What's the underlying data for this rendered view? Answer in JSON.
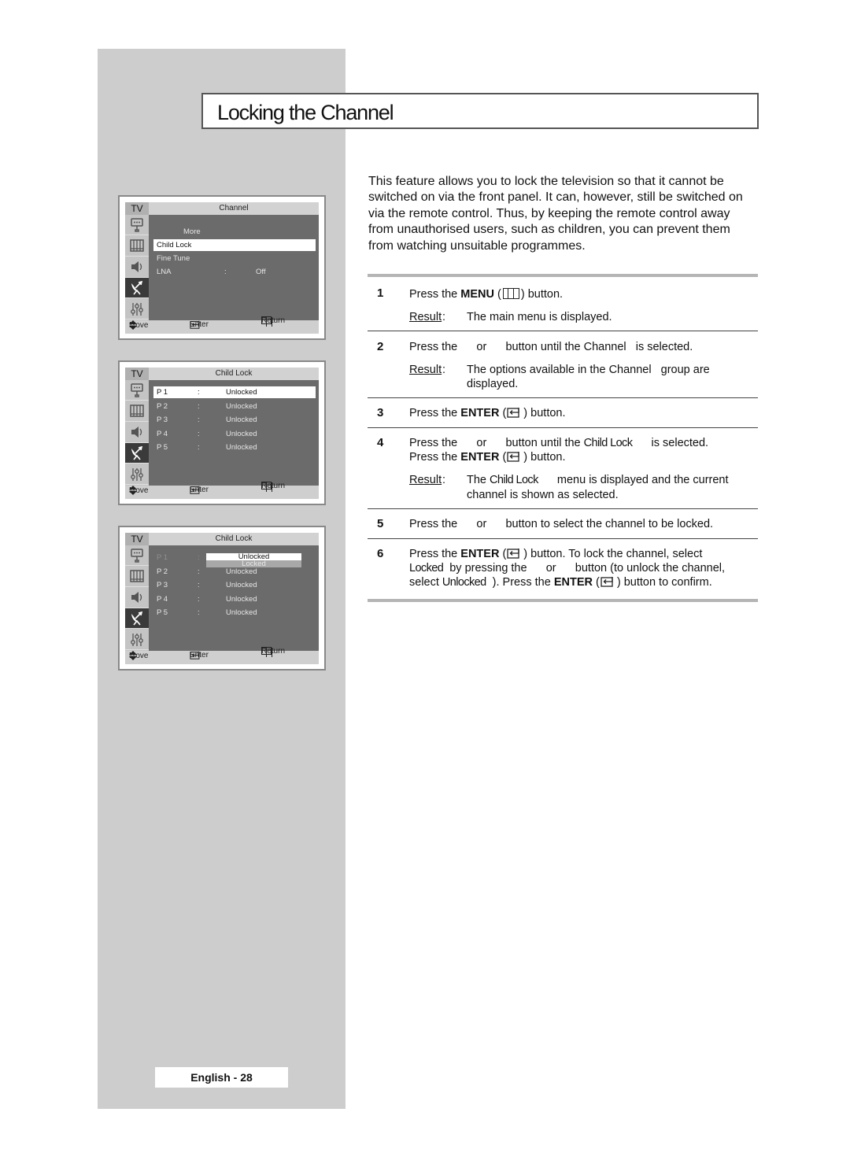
{
  "page": {
    "title": "Locking the Channel",
    "page_number": "English - 28"
  },
  "intro": "This feature allows you to lock the television so that it cannot be switched on via the front panel. It can, however, still be switched on via the remote control. Thus, by keeping the remote control away from unauthorised users, such as children, you can prevent them from watching unsuitable programmes.",
  "tv_common": {
    "tv_label": "TV",
    "footer": {
      "move": "Move",
      "enter": "Enter",
      "return": "Return"
    }
  },
  "menus": [
    {
      "title": "Channel",
      "rows": [
        {
          "c1": "More",
          "c2": "",
          "c3": "",
          "state": "normal",
          "indent": true
        },
        {
          "c1": "Child Lock",
          "c2": "",
          "c3": "",
          "state": "selected"
        },
        {
          "c1": "Fine Tune",
          "c2": "",
          "c3": "",
          "state": "normal"
        },
        {
          "c1": "LNA",
          "c2": ":",
          "c3": "Off",
          "state": "normal"
        }
      ]
    },
    {
      "title": "Child Lock",
      "rows": [
        {
          "c1": "P 1",
          "c2": ":",
          "c3": "Unlocked",
          "state": "selected"
        },
        {
          "c1": "P 2",
          "c2": ":",
          "c3": "Unlocked",
          "state": "normal"
        },
        {
          "c1": "P 3",
          "c2": ":",
          "c3": "Unlocked",
          "state": "normal"
        },
        {
          "c1": "P 4",
          "c2": ":",
          "c3": "Unlocked",
          "state": "normal"
        },
        {
          "c1": "P 5",
          "c2": ":",
          "c3": "Unlocked",
          "state": "normal"
        }
      ]
    },
    {
      "title": "Child Lock",
      "rows": [
        {
          "c1": "P 1",
          "c2": ":",
          "c3": "",
          "state": "dim"
        },
        {
          "c1": "P 2",
          "c2": ":",
          "c3": "Unlocked",
          "state": "normal"
        },
        {
          "c1": "P 3",
          "c2": ":",
          "c3": "Unlocked",
          "state": "normal"
        },
        {
          "c1": "P 4",
          "c2": ":",
          "c3": "Unlocked",
          "state": "normal"
        },
        {
          "c1": "P 5",
          "c2": ":",
          "c3": "Unlocked",
          "state": "normal"
        }
      ],
      "popup": {
        "highlighted": "Unlocked",
        "other": "Locked"
      }
    }
  ],
  "steps": {
    "result_label": "Result",
    "s1": {
      "num": "1",
      "pre": "Press the ",
      "key": "MENU",
      "post": " button.",
      "result": "The main menu is displayed."
    },
    "s2": {
      "num": "2",
      "line": "Press the      or      button until the Channel   is selected.",
      "result1": "The options available in the Channel   group are",
      "result2": "displayed."
    },
    "s3": {
      "num": "3",
      "pre": "Press the ",
      "key": "ENTER",
      "post": " button."
    },
    "s4": {
      "num": "4",
      "line1a": "Press the      or      button until the ",
      "line1b": "Child Lock",
      "line1c": "      is selected.",
      "pre2": "Press the ",
      "key2": "ENTER",
      "post2": " button.",
      "result1a": "The ",
      "result1b": "Child Lock",
      "result1c": "      menu is displayed and the current",
      "result2": "channel is shown as selected."
    },
    "s5": {
      "num": "5",
      "line": "Press the      or      button to select the channel to be locked."
    },
    "s6": {
      "num": "6",
      "pre1": "Press the ",
      "key1": "ENTER",
      "post1": " button. To lock the channel, select",
      "l2a": "Locked",
      "l2b": "  by pressing the      or      button (to unlock the channel,",
      "l3a": "select ",
      "l3b": "Unlocked",
      "l3c": "  ). Press the ",
      "key3": "ENTER",
      "l3d": " button to confirm."
    }
  }
}
